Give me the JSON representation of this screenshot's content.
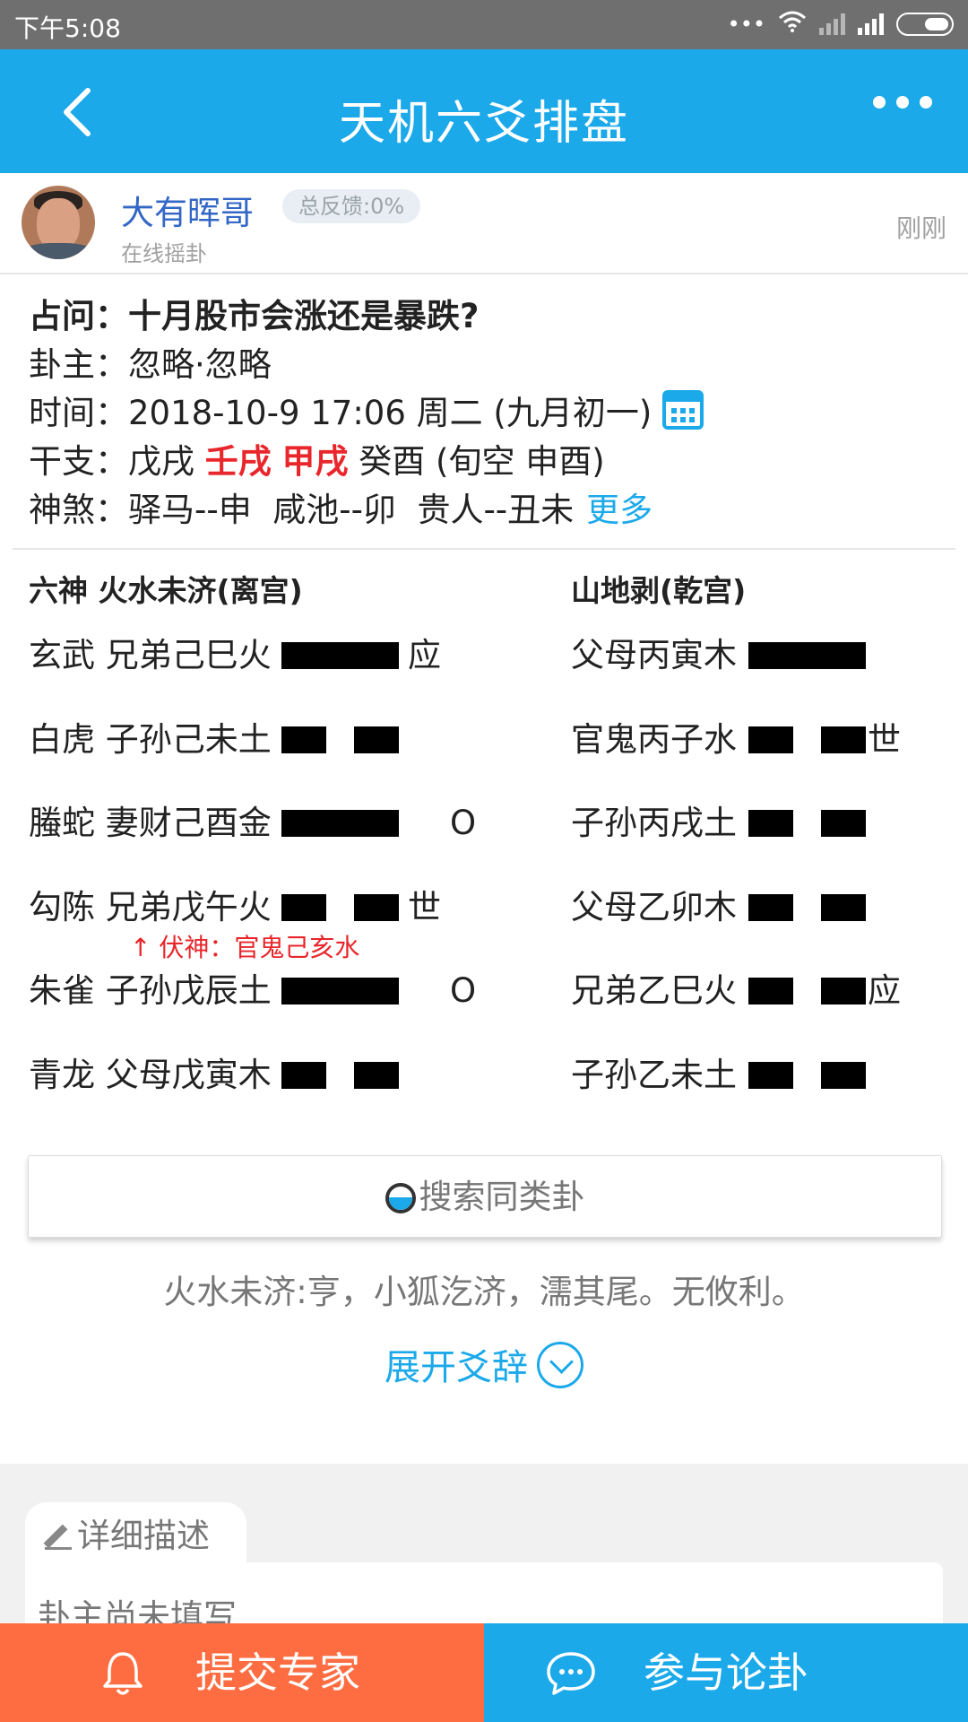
{
  "status_bar": {
    "time": "下午5:08"
  },
  "app_bar": {
    "title": "天机六爻排盘"
  },
  "user": {
    "name": "大有晖哥",
    "feedback": "总反馈:0%",
    "subtitle": "在线摇卦",
    "time_ago": "刚刚"
  },
  "info": {
    "question_label": "占问：",
    "question": "十月股市会涨还是暴跌?",
    "owner_label": "卦主：",
    "owner": "忽略·忽略",
    "time_label": "时间：",
    "time": "2018-10-9 17:06 周二 (九月初一)",
    "ganzhi_label": "干支：",
    "ganzhi_1": "戊戌",
    "ganzhi_2": "壬戌",
    "ganzhi_3": "甲戌",
    "ganzhi_4": "癸酉 (旬空 申酉)",
    "shensha_label": "神煞：",
    "shensha": "驿马--申  咸池--卯  贵人--丑未",
    "more_link": "更多"
  },
  "hexagram": {
    "left_title": "六神 火水未济(离宫)",
    "right_title": "山地剥(乾宫)",
    "left_rows": [
      {
        "text": "玄武 兄弟己巳火",
        "yang": true,
        "mark": "应",
        "moving": ""
      },
      {
        "text": "白虎 子孙己未土",
        "yang": false,
        "mark": "",
        "moving": ""
      },
      {
        "text": "螣蛇 妻财己酉金",
        "yang": true,
        "mark": "",
        "moving": "O"
      },
      {
        "text": "勾陈 兄弟戊午火",
        "yang": false,
        "mark": "世",
        "moving": ""
      },
      {
        "text": "朱雀 子孙戊辰土",
        "yang": true,
        "mark": "",
        "moving": "O"
      },
      {
        "text": "青龙 父母戊寅木",
        "yang": false,
        "mark": "",
        "moving": ""
      }
    ],
    "right_rows": [
      {
        "text": "父母丙寅木",
        "yang": true,
        "mark": ""
      },
      {
        "text": "官鬼丙子水",
        "yang": false,
        "mark": "世"
      },
      {
        "text": "子孙丙戌土",
        "yang": false,
        "mark": ""
      },
      {
        "text": "父母乙卯木",
        "yang": false,
        "mark": ""
      },
      {
        "text": "兄弟乙巳火",
        "yang": false,
        "mark": "应"
      },
      {
        "text": "子孙乙未土",
        "yang": false,
        "mark": ""
      }
    ],
    "fushen": "↑ 伏神：官鬼己亥水"
  },
  "search_button": "搜索同类卦",
  "hex_description": "火水未济:亨，小狐汔济，濡其尾。无攸利。",
  "expand_label": "展开爻辞",
  "detail": {
    "tab_label": "详细描述",
    "placeholder_text": "卦主尚未填写"
  },
  "bottom_bar": {
    "expert_label": "提交专家",
    "discuss_label": "参与论卦"
  },
  "colors": {
    "primary": "#1ba9ea",
    "accent_orange": "#fe6d41",
    "highlight_red": "#e8262b",
    "user_name": "#3367c6"
  }
}
